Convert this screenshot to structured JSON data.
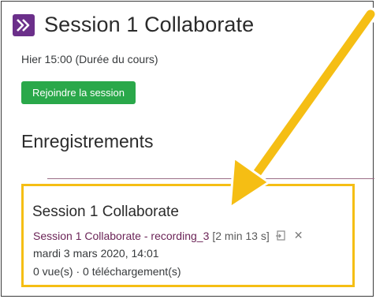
{
  "header": {
    "title": "Session 1 Collaborate",
    "icon": "collaborate-icon"
  },
  "session": {
    "date_text": "Hier 15:00 (Durée du cours)",
    "join_label": "Rejoindre la session"
  },
  "recordings": {
    "section_title": "Enregistrements",
    "item": {
      "title": "Session 1 Collaborate",
      "link_text": "Session 1 Collaborate - recording_3",
      "duration": "[2 min 13 s]",
      "date": "mardi 3 mars 2020, 14:01",
      "stats": "0 vue(s) · 0 téléchargement(s)"
    }
  },
  "colors": {
    "accent": "#f5be14",
    "join_button": "#2aa84a",
    "link": "#6b2457",
    "icon_bg": "#6b2f8a"
  }
}
